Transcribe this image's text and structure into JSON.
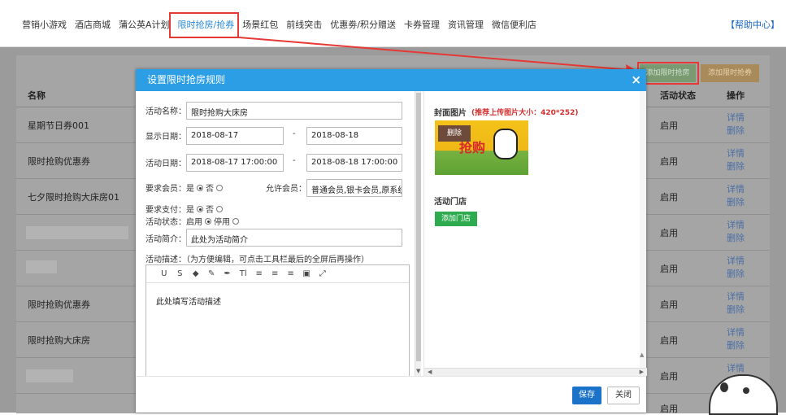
{
  "nav": {
    "items": [
      "营销小游戏",
      "酒店商城",
      "蒲公英A计划",
      "限时抢房/抢券",
      "场景红包",
      "前线突击",
      "优惠劵/积分赠送",
      "卡券管理",
      "资讯管理",
      "微信便利店"
    ],
    "active_index": 3,
    "help": "【帮助中心】"
  },
  "top_buttons": {
    "add": "添加限时抢房",
    "add2": "添加限时抢券"
  },
  "table": {
    "headers": {
      "name": "名称",
      "status": "活动状态",
      "ops": "操作"
    },
    "rows": [
      {
        "name": "星期节日券001",
        "status": "启用"
      },
      {
        "name": "限时抢购优惠券",
        "status": "启用"
      },
      {
        "name": "七夕限时抢购大床房01",
        "status": "启用"
      },
      {
        "name": "",
        "status": "启用"
      },
      {
        "name": "",
        "status": "启用"
      },
      {
        "name": "限时抢购优惠券",
        "status": "启用"
      },
      {
        "name": "限时抢购大床房",
        "status": "启用"
      },
      {
        "name": "",
        "status": "启用"
      },
      {
        "name": "",
        "status": "启用"
      }
    ],
    "op_detail": "详情",
    "op_delete": "删除"
  },
  "dialog": {
    "title": "设置限时抢房规则",
    "close_icon": "×",
    "fields": {
      "name_label": "活动名称：",
      "name_value": "限时抢购大床房",
      "show_date_label": "显示日期：",
      "show_date_from": "2018-08-17",
      "show_date_to": "2018-08-18",
      "act_date_label": "活动日期：",
      "act_date_from": "2018-08-17 17:00:00",
      "act_date_to": "2018-08-18 17:00:00",
      "dash": "-",
      "member_label": "要求会员：是",
      "no": "否",
      "allow_label": "允许会员：",
      "allow_value": "普通会员,银卡会员,原系统",
      "pay_label": "要求支付：是",
      "status_label": "活动状态：启用",
      "stop": "停用",
      "intro_label": "活动简介：",
      "intro_value": "此处为活动简介",
      "desc_label": "活动描述：（为方便编辑，可点击工具栏最后的全屏后再操作）",
      "editor_text": "此处填写活动描述"
    },
    "toolbar": [
      "U",
      "S",
      "◆",
      "✎",
      "✒",
      "Tl",
      "≡",
      "≡",
      "≡",
      "▣",
      "⤢"
    ],
    "cover_label": "封面图片",
    "cover_hint": "(推荐上传图片大小：420*252)",
    "cover_delete": "删除",
    "cover_sale_text": "抢购",
    "store_label": "活动门店",
    "add_store": "添加门店",
    "save": "保存",
    "close": "关闭"
  }
}
